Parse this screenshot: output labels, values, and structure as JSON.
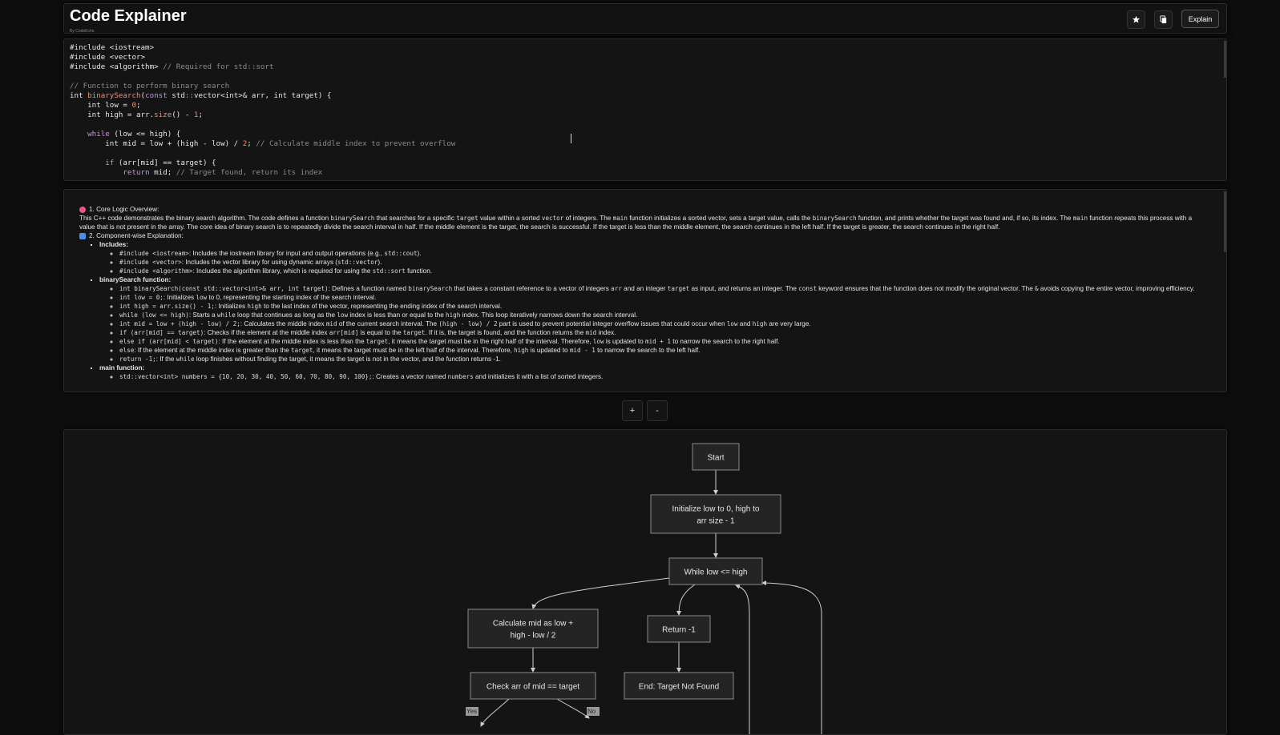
{
  "header": {
    "title": "Code Explainer",
    "byline": "By CodeEcho",
    "explain_label": "Explain"
  },
  "editor": {
    "lines": [
      [
        {
          "t": "#include ",
          "c": "ty"
        },
        {
          "t": "<iostream>",
          "c": "ty"
        }
      ],
      [
        {
          "t": "#include ",
          "c": "ty"
        },
        {
          "t": "<vector>",
          "c": "ty"
        }
      ],
      [
        {
          "t": "#include ",
          "c": "ty"
        },
        {
          "t": "<algorithm>",
          "c": "ty"
        },
        {
          "t": " // Required for std::sort",
          "c": "cm"
        }
      ],
      [],
      [
        {
          "t": "// Function to perform binary search",
          "c": "cm"
        }
      ],
      [
        {
          "t": "int ",
          "c": "ty"
        },
        {
          "t": "binarySearch",
          "c": "fn"
        },
        {
          "t": "(",
          "c": "ty"
        },
        {
          "t": "const ",
          "c": "kw"
        },
        {
          "t": "std",
          "c": "ty"
        },
        {
          "t": "::",
          "c": "kw"
        },
        {
          "t": "vector<int>& arr, int target) {",
          "c": "ty"
        }
      ],
      [
        {
          "t": "    int low = ",
          "c": "ty"
        },
        {
          "t": "0",
          "c": "num"
        },
        {
          "t": ";",
          "c": "ty"
        }
      ],
      [
        {
          "t": "    int high = arr.",
          "c": "ty"
        },
        {
          "t": "size",
          "c": "fn"
        },
        {
          "t": "() - ",
          "c": "ty"
        },
        {
          "t": "1",
          "c": "num"
        },
        {
          "t": ";",
          "c": "ty"
        }
      ],
      [],
      [
        {
          "t": "    ",
          "c": "ty"
        },
        {
          "t": "while",
          "c": "kw"
        },
        {
          "t": " (low <= high) {",
          "c": "ty"
        }
      ],
      [
        {
          "t": "        int mid = low + (high - low) / ",
          "c": "ty"
        },
        {
          "t": "2",
          "c": "num"
        },
        {
          "t": "; ",
          "c": "ty"
        },
        {
          "t": "// Calculate middle index to prevent overflow",
          "c": "cm"
        }
      ],
      [],
      [
        {
          "t": "        ",
          "c": "ty"
        },
        {
          "t": "if",
          "c": "kw"
        },
        {
          "t": " (arr[mid] == target) {",
          "c": "ty"
        }
      ],
      [
        {
          "t": "            ",
          "c": "ty"
        },
        {
          "t": "return",
          "c": "kw"
        },
        {
          "t": " mid; ",
          "c": "ty"
        },
        {
          "t": "// Target found, return its index",
          "c": "cm"
        }
      ]
    ]
  },
  "explanation": {
    "section1_title": "1. Core Logic Overview:",
    "section1_body_html": "This C++ code demonstrates the binary search algorithm. The code defines a function <code>binarySearch</code> that searches for a specific <code>target</code> value within a sorted <code>vector</code> of integers. The <code>main</code> function initializes a sorted vector, sets a target value, calls the <code>binarySearch</code> function, and prints whether the target was found and, if so, its index. The <code>main</code> function repeats this process with a value that is not present in the array. The core idea of binary search is to repeatedly divide the search interval in half. If the middle element is the target, the search is successful. If the target is less than the middle element, the search continues in the left half. If the target is greater, the search continues in the right half.",
    "section2_title": "2. Component-wise Explanation:",
    "groups": [
      {
        "title": "Includes:",
        "items": [
          "<code>#include &lt;iostream&gt;</code>: Includes the iostream library for input and output operations (e.g., <code>std::cout</code>).",
          "<code>#include &lt;vector&gt;</code>: Includes the vector library for using dynamic arrays (<code>std::vector</code>).",
          "<code>#include &lt;algorithm&gt;</code>: Includes the algorithm library, which is required for using the <code>std::sort</code> function."
        ]
      },
      {
        "title": "binarySearch function:",
        "items": [
          "<code>int binarySearch(const std::vector&lt;int&gt;&amp; arr, int target)</code>: Defines a function named <code>binarySearch</code> that takes a constant reference to a vector of integers <code>arr</code> and an integer <code>target</code> as input, and returns an integer. The <code>const</code> keyword ensures that the function does not modify the original vector. The <code>&amp;</code> avoids copying the entire vector, improving efficiency.",
          "<code>int low = 0;</code>: Initializes <code>low</code> to 0, representing the starting index of the search interval.",
          "<code>int high = arr.size() - 1;</code>: Initializes <code>high</code> to the last index of the vector, representing the ending index of the search interval.",
          "<code>while (low &lt;= high)</code>: Starts a <code>while</code> loop that continues as long as the <code>low</code> index is less than or equal to the <code>high</code> index. This loop iteratively narrows down the search interval.",
          "<code>int mid = low + (high - low) / 2;</code>: Calculates the middle index <code>mid</code> of the current search interval. The <code>(high - low) / 2</code> part is used to prevent potential integer overflow issues that could occur when <code>low</code> and <code>high</code> are very large.",
          "<code>if (arr[mid] == target)</code>: Checks if the element at the middle index <code>arr[mid]</code> is equal to the <code>target</code>. If it is, the target is found, and the function returns the <code>mid</code> index.",
          "<code>else if (arr[mid] &lt; target)</code>: If the element at the middle index is less than the <code>target</code>, it means the target must be in the right half of the interval. Therefore, <code>low</code> is updated to <code>mid + 1</code> to narrow the search to the right half.",
          "<code>else</code>: If the element at the middle index is greater than the <code>target</code>, it means the target must be in the left half of the interval. Therefore, <code>high</code> is updated to <code>mid - 1</code> to narrow the search to the left half.",
          "<code>return -1;</code>: If the <code>while</code> loop finishes without finding the target, it means the target is not in the vector, and the function returns -1."
        ]
      },
      {
        "title": "main function:",
        "items": [
          "<code>std::vector&lt;int&gt; numbers = {10, 20, 30, 40, 50, 60, 70, 80, 90, 100};</code>: Creates a vector named <code>numbers</code> and initializes it with a list of sorted integers."
        ]
      }
    ]
  },
  "zoom": {
    "in_label": "+",
    "out_label": "-"
  },
  "flowchart": {
    "nodes": [
      {
        "id": "start",
        "lines": [
          "Start"
        ]
      },
      {
        "id": "init",
        "lines": [
          "Initialize low to 0, high to",
          "arr size - 1"
        ]
      },
      {
        "id": "while",
        "lines": [
          "While low <= high"
        ]
      },
      {
        "id": "calc",
        "lines": [
          "Calculate mid as low +",
          "high - low / 2"
        ]
      },
      {
        "id": "ret",
        "lines": [
          "Return -1"
        ]
      },
      {
        "id": "check",
        "lines": [
          "Check arr of mid == target"
        ]
      },
      {
        "id": "end",
        "lines": [
          "End: Target Not Found"
        ]
      }
    ],
    "edge_labels": {
      "yes": "Yes",
      "no": "No"
    }
  },
  "colors": {
    "background": "#0d0d0d",
    "panel": "#141414",
    "node_fill": "#242424",
    "node_stroke": "#8a8a8a",
    "edge": "#cfcfcf",
    "section1_icon": "#e05a8a",
    "section2_icon": "#4a8fe7"
  }
}
